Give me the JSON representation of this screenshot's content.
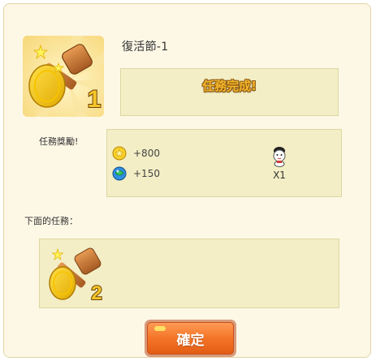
{
  "mission": {
    "title": "復活節-1",
    "status": "任務完成!",
    "icon": "golden-hammer-icon",
    "badge": "1"
  },
  "rewards": {
    "label": "任務獎勵!",
    "coins": {
      "icon": "gold-coin-icon",
      "text": "+800"
    },
    "exp": {
      "icon": "blue-gem-icon",
      "text": "+150"
    },
    "item": {
      "icon": "bunny-doll-icon",
      "qty": "X1"
    }
  },
  "next": {
    "label": "下面的任務：",
    "icon": "golden-hammer-icon",
    "badge": "2"
  },
  "confirm_label": "確定",
  "colors": {
    "background": "#fdf8e6",
    "box_fill": "#f3eec5",
    "status_text": "#f4b52a",
    "button": "#f47527"
  }
}
